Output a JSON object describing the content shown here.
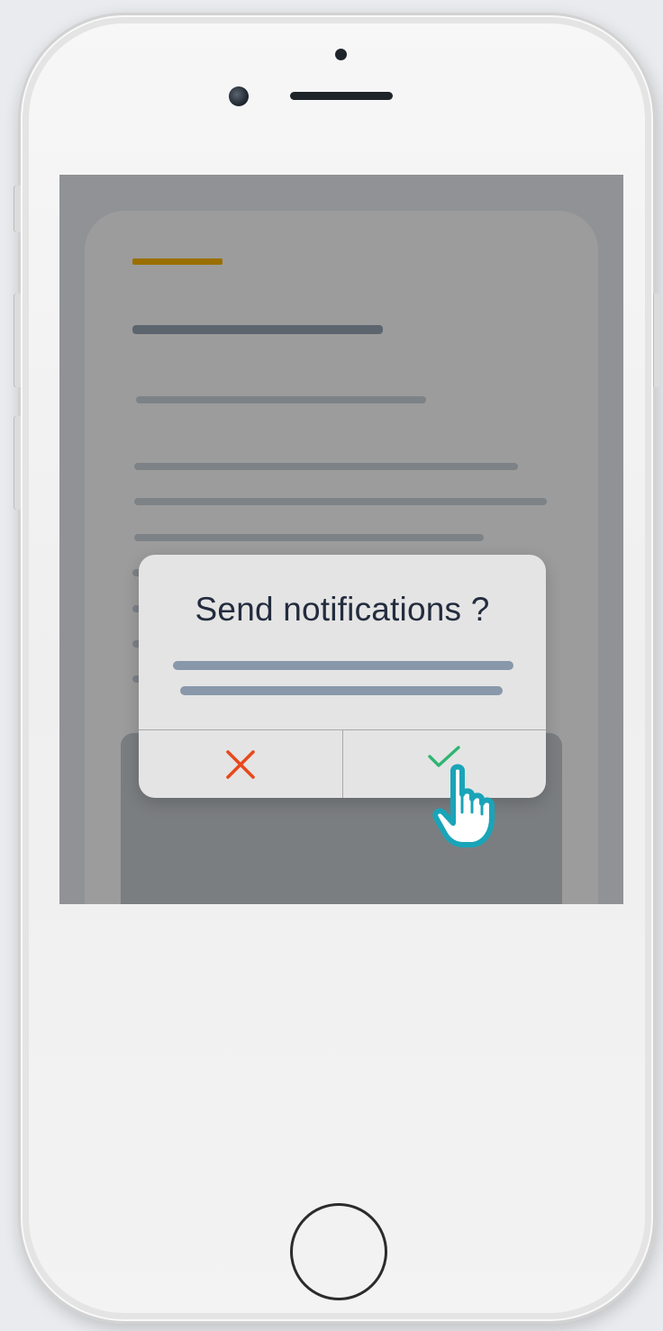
{
  "dialog": {
    "title": "Send notifications ?",
    "cancel_icon": "close-icon",
    "confirm_icon": "check-icon"
  },
  "colors": {
    "accent": "#9a6f00",
    "cancel": "#e8481c",
    "confirm": "#2fb573",
    "cursor": "#1aa4b8",
    "title_text": "#232c3e"
  },
  "cursor_icon": "pointing-hand-icon"
}
